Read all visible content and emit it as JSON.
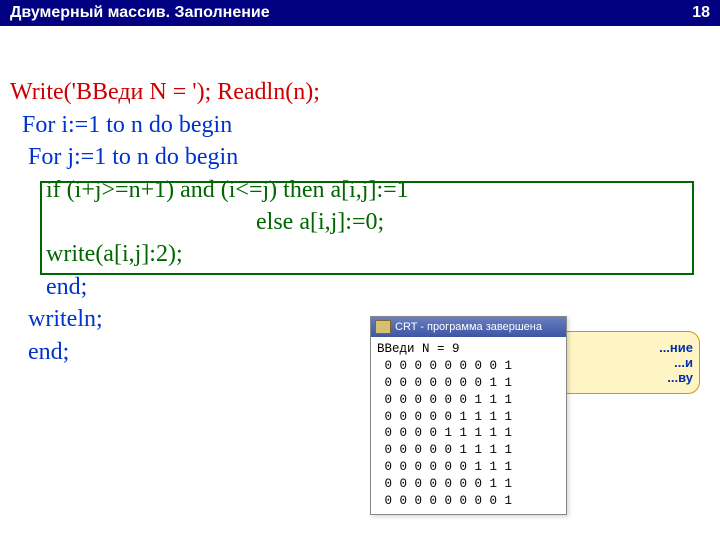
{
  "header": {
    "title": "Двумерный массив. Заполнение",
    "page": "18"
  },
  "code": {
    "l1a": "Write('ВВеди N = '); Readln(n);",
    "l2": "  For i:=1 to n do begin",
    "l3": "   For j:=1 to n do begin",
    "l4": "      if (i+j>=n+1) and (i<=j) then a[i,j]:=1",
    "l5": "                                         else a[i,j]:=0;",
    "l6": "      write(a[i,j]:2);",
    "l7": "      end;",
    "l8": "   writeln;",
    "l9": "   end;"
  },
  "balloon": {
    "l1": "...ние",
    "l2": "...и",
    "l3": "...ву"
  },
  "console": {
    "title": "CRT - программа завершена",
    "prompt": "ВВеди N = 9"
  },
  "chart_data": {
    "type": "table",
    "title": "Output matrix (N=9)",
    "rows": [
      [
        0,
        0,
        0,
        0,
        0,
        0,
        0,
        0,
        1
      ],
      [
        0,
        0,
        0,
        0,
        0,
        0,
        0,
        1,
        1
      ],
      [
        0,
        0,
        0,
        0,
        0,
        0,
        1,
        1,
        1
      ],
      [
        0,
        0,
        0,
        0,
        0,
        1,
        1,
        1,
        1
      ],
      [
        0,
        0,
        0,
        0,
        1,
        1,
        1,
        1,
        1
      ],
      [
        0,
        0,
        0,
        0,
        0,
        1,
        1,
        1,
        1
      ],
      [
        0,
        0,
        0,
        0,
        0,
        0,
        1,
        1,
        1
      ],
      [
        0,
        0,
        0,
        0,
        0,
        0,
        0,
        1,
        1
      ],
      [
        0,
        0,
        0,
        0,
        0,
        0,
        0,
        0,
        1
      ]
    ]
  }
}
